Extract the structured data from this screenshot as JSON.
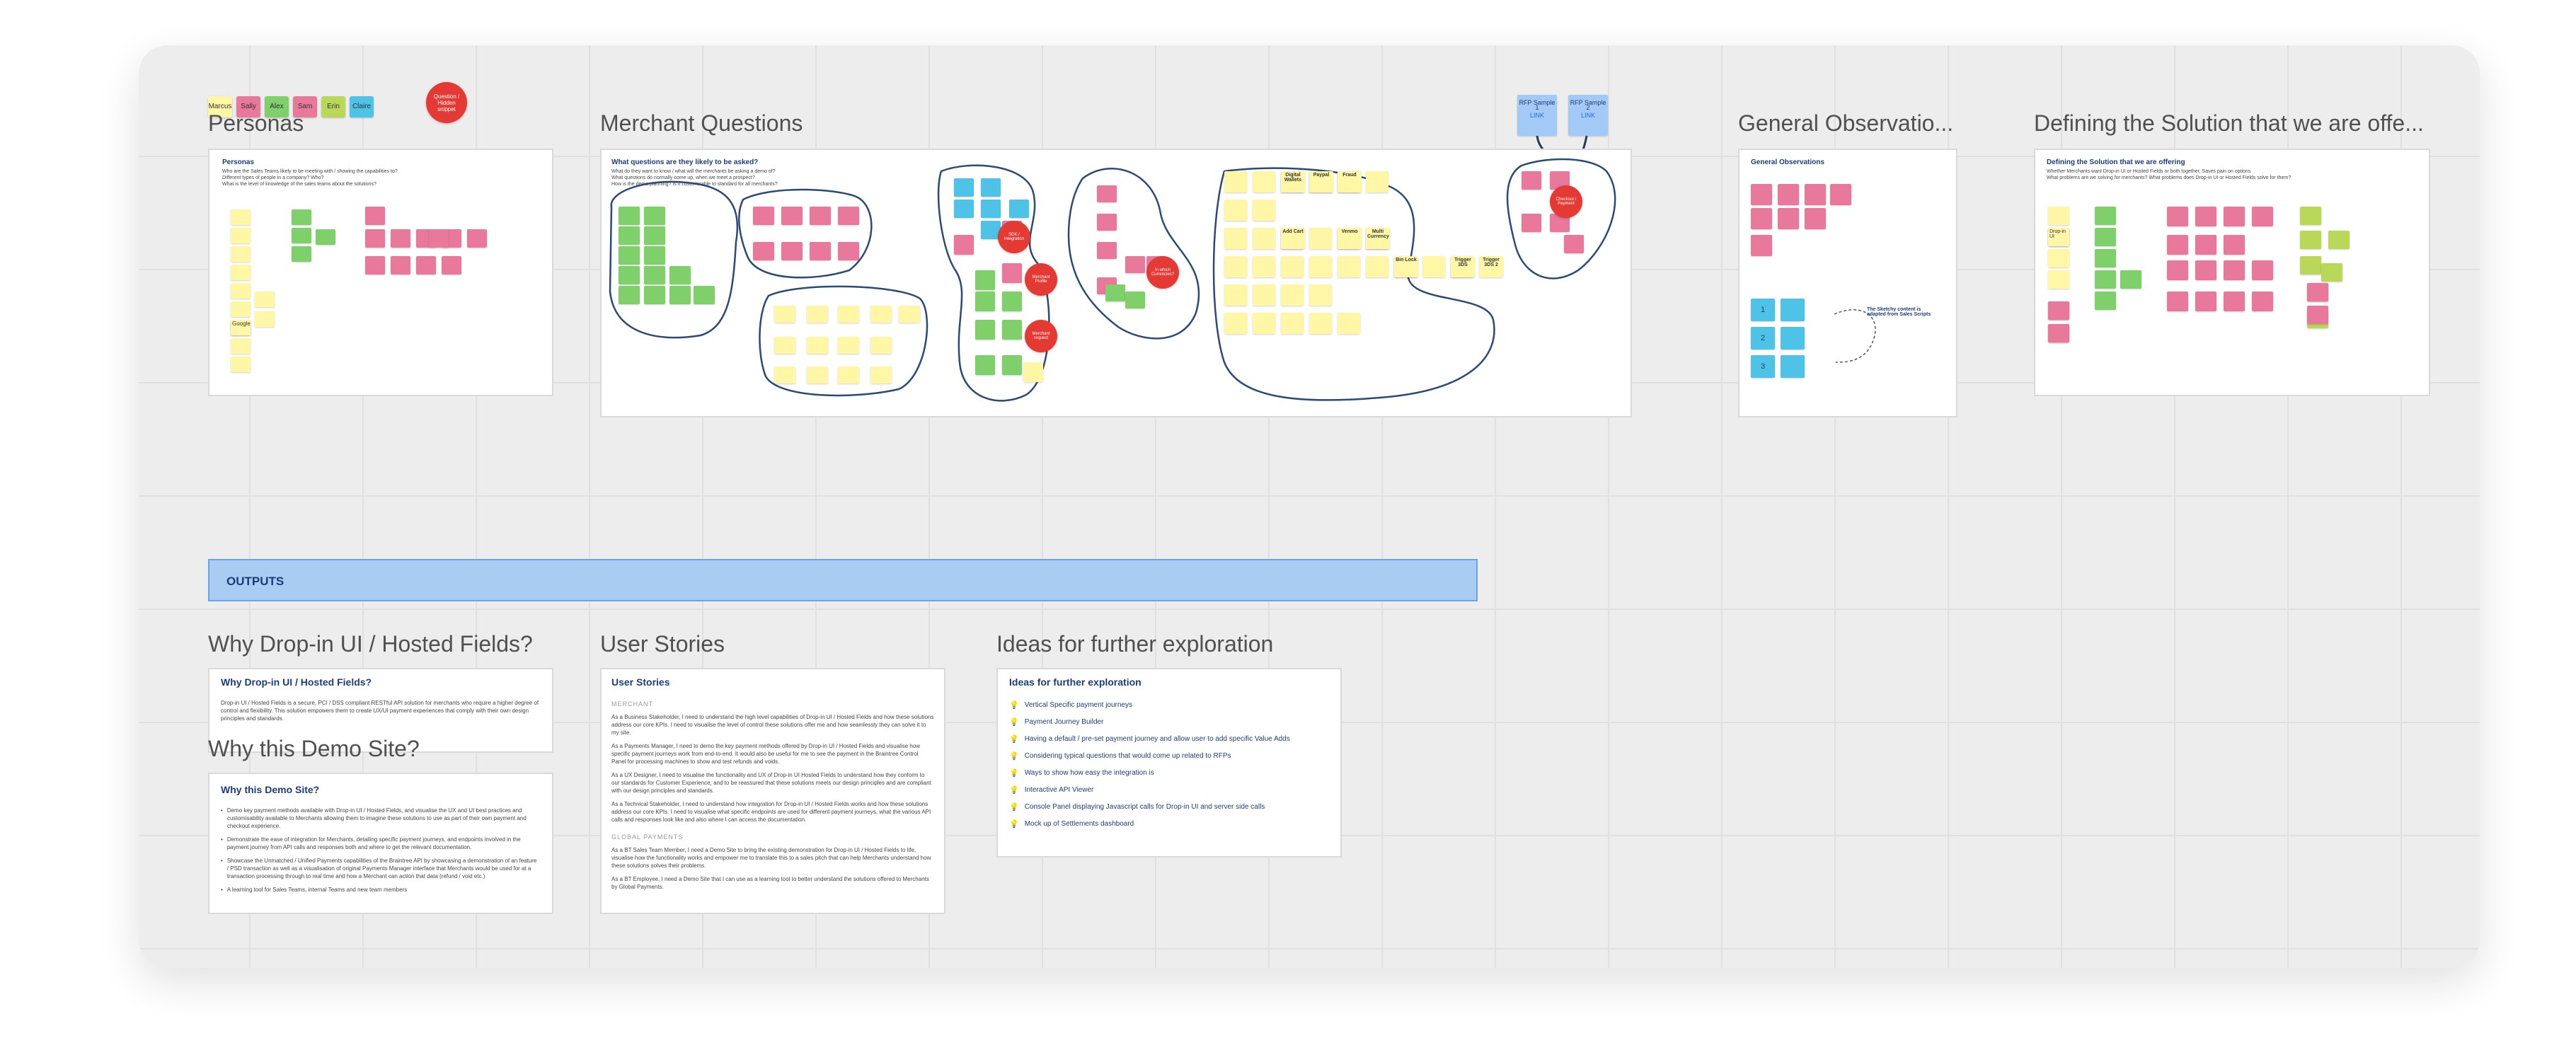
{
  "legend": {
    "items": [
      {
        "label": "Marcus",
        "color": "#fff7a6"
      },
      {
        "label": "Sally",
        "color": "#e8799c"
      },
      {
        "label": "Alex",
        "color": "#7fcf6b"
      },
      {
        "label": "Sam",
        "color": "#e8799c"
      },
      {
        "label": "Erin",
        "color": "#b9d85a"
      },
      {
        "label": "Claire",
        "color": "#4fc2e7"
      }
    ],
    "question_badge": "Question / Hidden snippet"
  },
  "rfp": {
    "sample1": "RFP Sample 1",
    "sample2": "RFP Sample 2",
    "link": "LINK"
  },
  "frames": {
    "personas": {
      "title": "Personas",
      "heading": "Personas",
      "questions": [
        "Who are the Sales Teams likely to be meeting with / showing the capabilities to?",
        "Different types of people in a company? Who?",
        "What is the level of knowledge of the sales teams about the solutions?"
      ],
      "example_note": "Google"
    },
    "merchant_questions": {
      "title": "Merchant Questions",
      "heading": "What questions are they likely to be asked?",
      "questions": [
        "What do they want to know / what will the merchants be asking a demo of?",
        "What questions do normally come up, when we meet a prospect?",
        "How is the demo planning? Is it customisable to standard for all merchants?"
      ],
      "badges": [
        "Merchant Profile",
        "Merchant request",
        "In which Currencies?",
        "Checkout / Payment",
        "SDK / Integration"
      ],
      "notes": [
        "Digital Wallets",
        "Paypal",
        "Fraud",
        "Multi Currency",
        "Bin Lock",
        "Trigger 3DS",
        "Trigger 3DS 2",
        "Add Cart",
        "Venmo"
      ]
    },
    "general_observations": {
      "title": "General Observatio...",
      "heading": "General Observations",
      "steps": [
        "1",
        "2",
        "3"
      ],
      "flow_label": "The Sketchy content is adapted from Sales Scripts"
    },
    "defining_solution": {
      "title": "Defining the Solution that we are offe...",
      "heading": "Defining the Solution that we are offering",
      "questions": [
        "Whether Merchants want Drop-in UI or Hosted Fields or both together, Saves pain on options",
        "What problems are we solving for merchants? What problems does Drop-in UI or Hosted Fields solve for them?"
      ],
      "example_note": "Drop-in UI"
    },
    "outputs_banner": "OUTPUTS",
    "why_dropin": {
      "title": "Why Drop-in UI / Hosted Fields?",
      "heading": "Why Drop-in UI / Hosted Fields?",
      "body": "Drop-in UI / Hosted Fields is a secure, PCI / DSS compliant RESTful API solution for merchants who require a higher degree of control and flexibility. This solution empowers them to create UX/UI payment experiences that comply with their own design principles and standards."
    },
    "why_demo": {
      "title": "Why this Demo Site?",
      "heading": "Why this Demo Site?",
      "bullets": [
        "Demo key payment methods available with Drop-in UI / Hosted Fields, and visualise the UX and UI best practices and customisability available to Merchants allowing them to imagine these solutions to use as part of their own payment and checkout experience.",
        "Demonstrate the ease of integration for Merchants, detailing specific payment journeys, and endpoints involved in the payment journey from API calls and responses both and where to get the relevant documentation.",
        "Showcase the Unmatched / Unified Payments capabilities of the Braintree API by showcasing a demonstration of an feature / PSD transaction as well as a visualisation of original Payments Manager interface that Merchants would be used for at a transaction processing through to real time and how a Merchant can action that data (refund / void etc.)",
        "A learning tool for Sales Teams, internal Teams and new team members"
      ]
    },
    "user_stories": {
      "title": "User Stories",
      "heading": "User Stories",
      "sections": [
        {
          "label": "MERCHANT",
          "stories": [
            "As a Business Stakeholder, I need to understand the high level capabilities of Drop-in UI / Hosted Fields and how these solutions address our core KPIs. I need to visualise the level of control these solutions offer me and how seamlessly they can solve it to my site.",
            "As a Payments Manager, I need to demo the key payment methods offered by Drop-in UI / Hosted Fields and visualise how specific payment journeys work from end-to-end. It would also be useful for me to see the payment in the Braintree Control Panel for processing machines to show and test refunds and voids.",
            "As a UX Designer, I need to visualise the functionality and UX of Drop-in UI Hosted Fields to understand how they conform to our standards for Customer Experience, and to be reassured that these solutions meets our design principles and are compliant with our design principles and standards.",
            "As a Technical Stakeholder, I need to understand how integration for Drop-in UI / Hosted Fields works and how these solutions address our core KPIs. I need to visualise what specific endpoints are used for different payment journeys, what the various API calls and responses look like and also where I can access the documentation."
          ]
        },
        {
          "label": "GLOBAL PAYMENTS",
          "stories": [
            "As a BT Sales Team Member, I need a Demo Site to bring the existing demonstration for Drop-in UI / Hosted Fields to life, visualise how the functionality works and empower me to translate this to a sales pitch that can help Merchants understand how these solutions solves their problems.",
            "As a BT Employee, I need a Demo Site that I can use as a learning tool to better understand the solutions offered to Merchants by Global Payments."
          ]
        }
      ]
    },
    "ideas": {
      "title": "Ideas for further exploration",
      "heading": "Ideas for further exploration",
      "items": [
        "Vertical Specific payment journeys",
        "Payment Journey Builder",
        "Having a default / pre-set payment journey and allow user to add specific Value Adds",
        "Considering typical questions that would come up related to RFPs",
        "Ways to show how easy the integration is",
        "Interactive API Viewer",
        "Console Panel displaying Javascript calls for Drop-in UI and server side calls",
        "Mock up of Settlements dashboard"
      ]
    }
  }
}
